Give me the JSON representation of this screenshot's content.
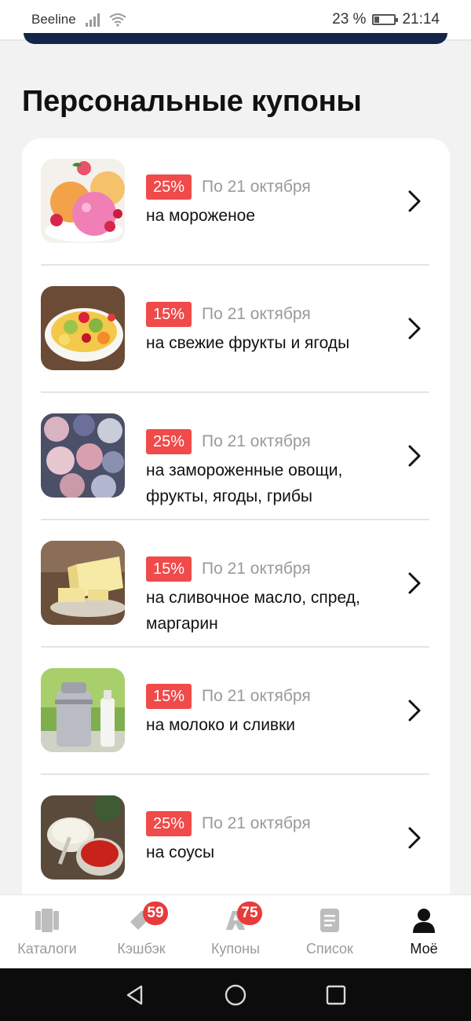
{
  "status_bar": {
    "carrier": "Beeline",
    "battery_text": "23 %",
    "battery_level": 0.23,
    "time": "21:14"
  },
  "section": {
    "title": "Персональные купоны"
  },
  "coupons": [
    {
      "discount": "25%",
      "date": "По 21 октября",
      "title": "на мороженое"
    },
    {
      "discount": "15%",
      "date": "По 21 октября",
      "title": "на свежие фрукты и ягоды"
    },
    {
      "discount": "25%",
      "date": "По 21 октября",
      "title": "на замороженные овощи, фрукты, ягоды, грибы"
    },
    {
      "discount": "15%",
      "date": "По 21 октября",
      "title": "на сливочное масло, спред, маргарин"
    },
    {
      "discount": "15%",
      "date": "По 21 октября",
      "title": "на молоко и сливки"
    },
    {
      "discount": "25%",
      "date": "По 21 октября",
      "title": "на соусы"
    }
  ],
  "bottom_nav": {
    "items": [
      {
        "label": "Каталоги",
        "icon": "catalog-icon"
      },
      {
        "label": "Кэшбэк",
        "icon": "cashback-icon",
        "badge": "59"
      },
      {
        "label": "Купоны",
        "icon": "coupon-icon",
        "badge": "75"
      },
      {
        "label": "Список",
        "icon": "list-icon"
      },
      {
        "label": "Моё",
        "icon": "profile-icon",
        "active": true
      }
    ]
  },
  "colors": {
    "accent_red": "#f04a4a",
    "badge_red": "#e83b3b",
    "navy": "#13264a"
  }
}
